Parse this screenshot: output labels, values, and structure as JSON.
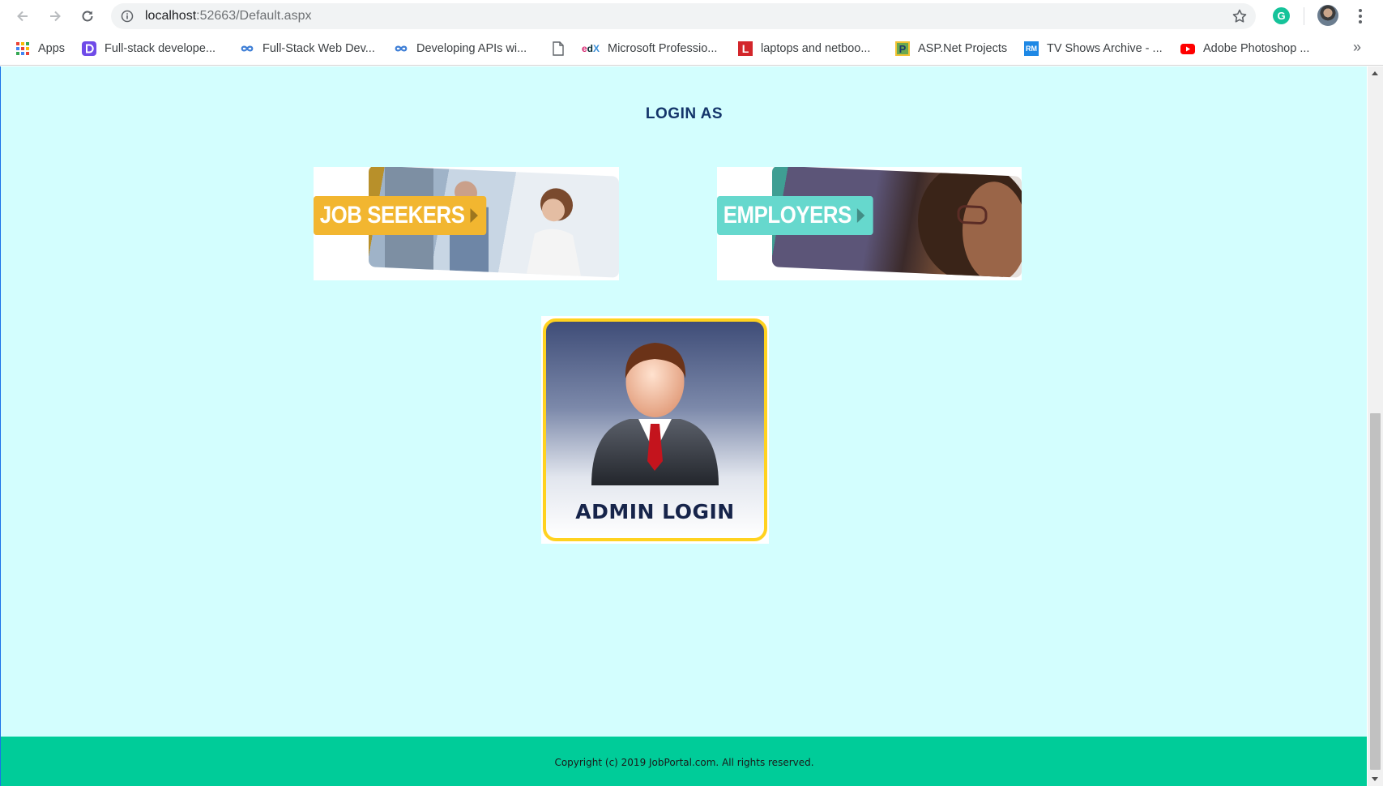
{
  "browser": {
    "url_host": "localhost",
    "url_rest": ":52663/Default.aspx",
    "extension_letter": "G"
  },
  "bookmarks": {
    "items": [
      {
        "label": "Apps",
        "icon": "apps-grid-icon"
      },
      {
        "label": "Full-stack develope...",
        "icon": "d-logo-icon"
      },
      {
        "label": "Full-Stack Web Dev...",
        "icon": "infinity-icon"
      },
      {
        "label": "Developing APIs wi...",
        "icon": "infinity-icon"
      },
      {
        "label": "",
        "icon": "document-icon"
      },
      {
        "label": "Microsoft Professio...",
        "icon": "edx-icon"
      },
      {
        "label": "laptops and netboo...",
        "icon": "l-logo-icon"
      },
      {
        "label": "ASP.Net Projects",
        "icon": "p-logo-icon"
      },
      {
        "label": "TV Shows Archive - ...",
        "icon": "rm-logo-icon"
      },
      {
        "label": "Adobe Photoshop ...",
        "icon": "youtube-icon"
      }
    ],
    "overflow": "»"
  },
  "page": {
    "heading": "LOGIN AS",
    "tiles": {
      "job_seekers": "JOB SEEKERS",
      "employers": "EMPLOYERS",
      "admin": "ADMIN LOGIN"
    },
    "footer": "Copyright (c) 2019 JobPortal.com. All rights reserved."
  },
  "colors": {
    "page_background": "#d3fefe",
    "heading": "#14356a",
    "footer_background": "#00cc99",
    "job_seekers_accent": "#f2b630",
    "employers_accent": "#66d8cd",
    "admin_border": "#ffd21f"
  }
}
